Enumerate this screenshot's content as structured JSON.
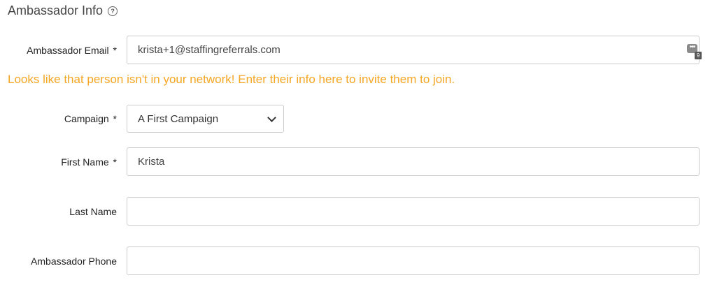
{
  "section": {
    "title": "Ambassador Info",
    "help_icon": "?"
  },
  "fields": {
    "email": {
      "label": "Ambassador Email",
      "required_mark": "*",
      "value": "krista+1@staffingreferrals.com"
    },
    "campaign": {
      "label": "Campaign",
      "required_mark": "*",
      "selected": "A First Campaign"
    },
    "first_name": {
      "label": "First Name",
      "required_mark": "*",
      "value": "Krista"
    },
    "last_name": {
      "label": "Last Name",
      "value": ""
    },
    "phone": {
      "label": "Ambassador Phone",
      "value": ""
    }
  },
  "warning": {
    "text": "Looks like that person isn't in your network! Enter their info here to invite them to join.",
    "color": "#f5a623"
  },
  "password_widget": {
    "icon": "password-manager-icon",
    "dots": "•••",
    "badge": "9"
  }
}
